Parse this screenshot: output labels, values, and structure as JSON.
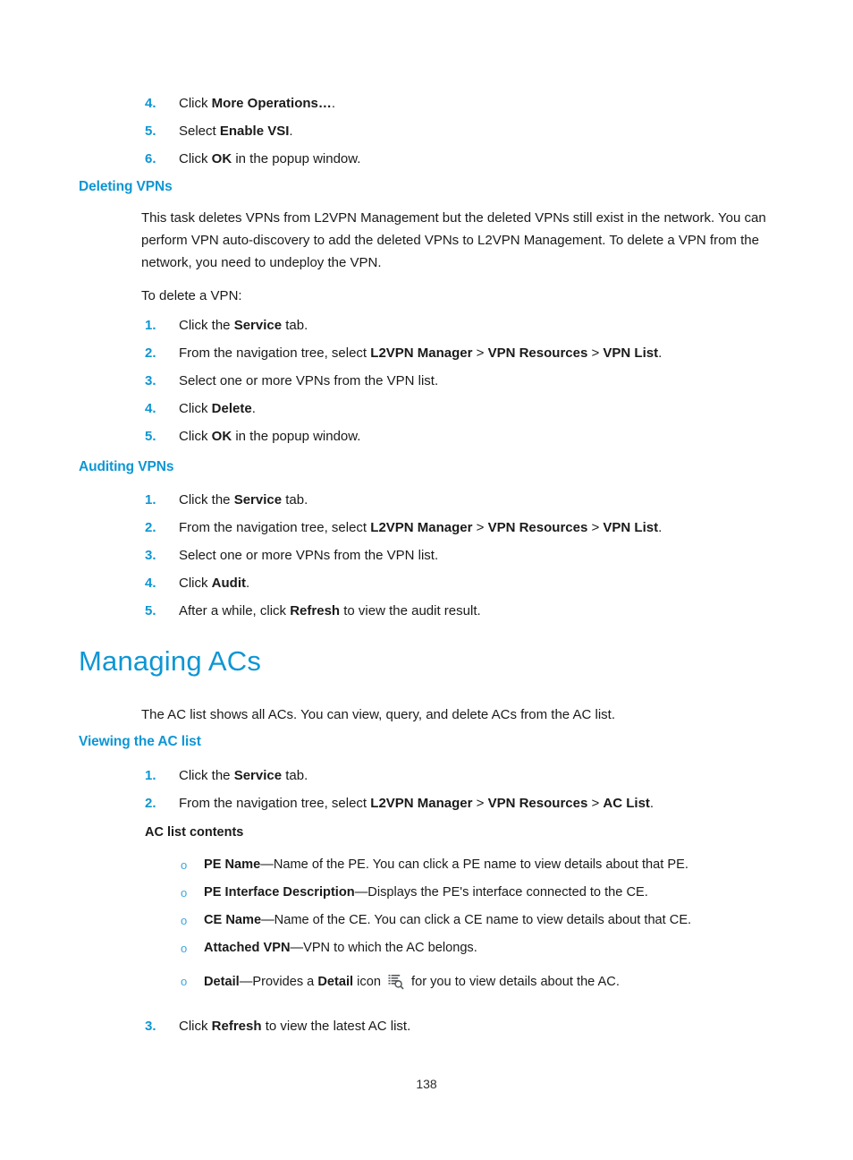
{
  "document": {
    "page_number": "138",
    "accent_color": "#0d96d4",
    "bullet_color": "#3aa6de",
    "text_color": "#1a1a1a"
  },
  "top_steps": {
    "items": [
      {
        "num": "4.",
        "pre": "Click ",
        "bold": "More Operations…",
        "post": "."
      },
      {
        "num": "5.",
        "pre": "Select ",
        "bold": "Enable VSI",
        "post": "."
      },
      {
        "num": "6.",
        "pre": "Click ",
        "bold": "OK",
        "post": " in the popup window."
      }
    ]
  },
  "deleting_vpns": {
    "heading": "Deleting VPNs",
    "paragraph": "This task deletes VPNs from L2VPN Management but the deleted VPNs still exist in the network. You can perform VPN auto-discovery to add the deleted VPNs to L2VPN Management. To delete a VPN from the network, you need to undeploy the VPN.",
    "lead_in": "To delete a VPN:",
    "steps": [
      {
        "num": "1.",
        "pre": "Click the ",
        "bold": "Service",
        "post": " tab."
      },
      {
        "num": "2.",
        "pre": "From the navigation tree, select ",
        "bold": "L2VPN Manager",
        "mid1": " > ",
        "bold2": "VPN Resources",
        "mid2": " > ",
        "bold3": "VPN List",
        "post": "."
      },
      {
        "num": "3.",
        "pre": "Select one or more VPNs from the VPN list.",
        "bold": "",
        "post": ""
      },
      {
        "num": "4.",
        "pre": "Click ",
        "bold": "Delete",
        "post": "."
      },
      {
        "num": "5.",
        "pre": "Click ",
        "bold": "OK",
        "post": " in the popup window."
      }
    ]
  },
  "auditing_vpns": {
    "heading": "Auditing VPNs",
    "steps": [
      {
        "num": "1.",
        "pre": "Click the ",
        "bold": "Service",
        "post": " tab."
      },
      {
        "num": "2.",
        "pre": "From the navigation tree, select ",
        "bold": "L2VPN Manager",
        "mid1": " > ",
        "bold2": "VPN Resources",
        "mid2": " > ",
        "bold3": "VPN List",
        "post": "."
      },
      {
        "num": "3.",
        "pre": "Select one or more VPNs from the VPN list.",
        "bold": "",
        "post": ""
      },
      {
        "num": "4.",
        "pre": "Click ",
        "bold": "Audit",
        "post": "."
      },
      {
        "num": "5.",
        "pre": "After a while, click ",
        "bold": "Refresh",
        "post": " to view the audit result."
      }
    ]
  },
  "managing_acs": {
    "heading": "Managing ACs",
    "paragraph": "The AC list shows all ACs. You can view, query, and delete ACs from the AC list.",
    "viewing_heading": "Viewing the AC list",
    "steps_before": [
      {
        "num": "1.",
        "pre": "Click the ",
        "bold": "Service",
        "post": " tab."
      },
      {
        "num": "2.",
        "pre": "From the navigation tree, select ",
        "bold": "L2VPN Manager",
        "mid1": " > ",
        "bold2": "VPN Resources",
        "mid2": " > ",
        "bold3": "AC List",
        "post": "."
      }
    ],
    "contents_heading": "AC list contents",
    "contents": [
      {
        "bullet": "o",
        "term": "PE Name",
        "dash": "—",
        "desc": "Name of the PE. You can click a PE name to view details about that PE."
      },
      {
        "bullet": "o",
        "term": "PE Interface Description",
        "dash": "—",
        "desc": "Displays the PE's interface connected to the CE."
      },
      {
        "bullet": "o",
        "term": "CE Name",
        "dash": "—",
        "desc": "Name of the CE. You can click a CE name to view details about that CE."
      },
      {
        "bullet": "o",
        "term": "Attached VPN",
        "dash": "—",
        "desc": "VPN to which the AC belongs."
      }
    ],
    "detail_item": {
      "bullet": "o",
      "term": "Detail",
      "dash": "—",
      "pre": "Provides a ",
      "bold": "Detail",
      "mid": " icon ",
      "icon_name": "detail-list-magnifier-icon",
      "post": " for you to view details about the AC."
    },
    "step_after": {
      "num": "3.",
      "pre": "Click ",
      "bold": "Refresh",
      "post": " to view the latest AC list."
    }
  }
}
